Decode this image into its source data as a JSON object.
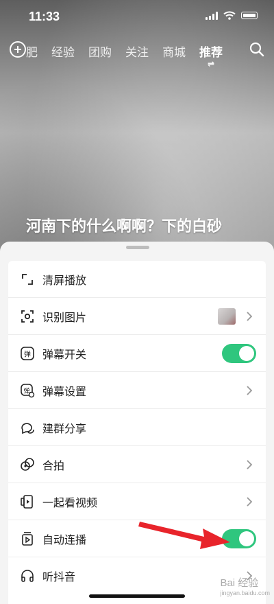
{
  "status_bar": {
    "time": "11:33"
  },
  "top_nav": {
    "tabs": [
      {
        "label": "减肥",
        "display": "肥",
        "active": false
      },
      {
        "label": "经验",
        "active": false
      },
      {
        "label": "团购",
        "active": false
      },
      {
        "label": "关注",
        "active": false
      },
      {
        "label": "商城",
        "active": false
      },
      {
        "label": "推荐",
        "active": true
      }
    ]
  },
  "video": {
    "caption": "河南下的什么啊啊？下的白砂"
  },
  "menu": {
    "items": [
      {
        "label": "清屏播放",
        "icon": "fullscreen-icon",
        "trailing": "none"
      },
      {
        "label": "识别图片",
        "icon": "scan-image-icon",
        "trailing": "thumbnail-chevron"
      },
      {
        "label": "弹幕开关",
        "icon": "danmaku-icon",
        "trailing": "toggle",
        "toggle_on": true
      },
      {
        "label": "弹幕设置",
        "icon": "danmaku-settings-icon",
        "trailing": "chevron"
      },
      {
        "label": "建群分享",
        "icon": "group-chat-icon",
        "trailing": "none"
      },
      {
        "label": "合拍",
        "icon": "duet-icon",
        "trailing": "chevron"
      },
      {
        "label": "一起看视频",
        "icon": "watch-together-icon",
        "trailing": "chevron"
      },
      {
        "label": "自动连播",
        "icon": "autoplay-icon",
        "trailing": "toggle",
        "toggle_on": true
      },
      {
        "label": "听抖音",
        "icon": "headphones-icon",
        "trailing": "chevron"
      }
    ]
  },
  "watermark": {
    "text": "Bai 经验",
    "sub": "jingyan.baidu.com"
  },
  "colors": {
    "toggle_on": "#2fc67e",
    "annotation_arrow": "#e8242b"
  }
}
